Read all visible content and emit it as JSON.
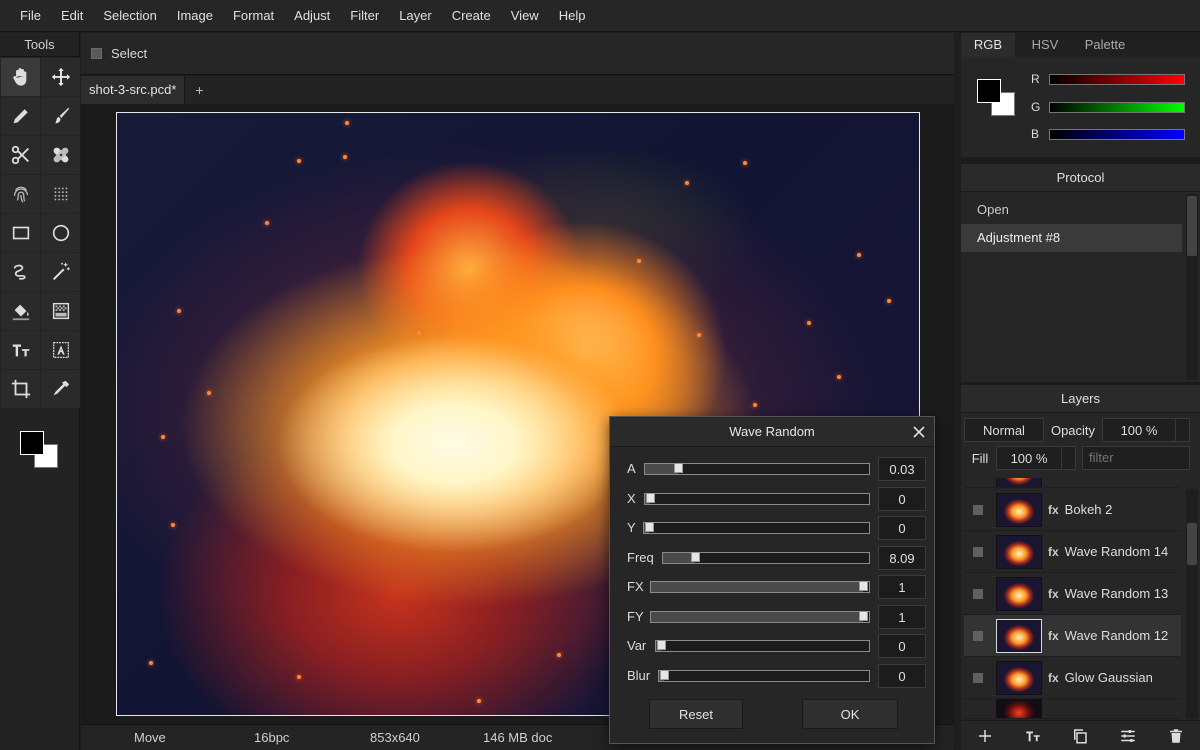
{
  "menu": [
    "File",
    "Edit",
    "Selection",
    "Image",
    "Format",
    "Adjust",
    "Filter",
    "Layer",
    "Create",
    "View",
    "Help"
  ],
  "tools": {
    "title": "Tools",
    "items": [
      "hand-icon",
      "move-icon",
      "pencil-icon",
      "brush-icon",
      "scissors-icon",
      "healing-icon",
      "fingerprint-icon",
      "dots-grid-icon",
      "rectangle-icon",
      "ellipse-icon",
      "lasso-icon",
      "magic-wand-icon",
      "fill-bucket-icon",
      "gradient-icon",
      "text-icon",
      "text-box-icon",
      "crop-icon",
      "eyedropper-icon"
    ],
    "fg_color": "#000000",
    "bg_color": "#ffffff"
  },
  "options": {
    "select_label": "Select"
  },
  "document": {
    "tab": "shot-3-src.pcd*",
    "add": "+"
  },
  "status": {
    "tool": "Move",
    "depth": "16bpc",
    "size": "853x640",
    "memory": "146 MB doc"
  },
  "color_panel": {
    "tabs": [
      "RGB",
      "HSV",
      "Palette"
    ],
    "channels": [
      {
        "label": "R",
        "color": "#ff0000"
      },
      {
        "label": "G",
        "color": "#00ff00"
      },
      {
        "label": "B",
        "color": "#0000ff"
      }
    ]
  },
  "protocol": {
    "title": "Protocol",
    "items": [
      "Open",
      "Adjustment  #8"
    ],
    "selected": 1
  },
  "layers": {
    "title": "Layers",
    "blend_mode": "Normal",
    "opacity_label": "Opacity",
    "opacity_value": "100 %",
    "fill_label": "Fill",
    "fill_value": "100 %",
    "filter_placeholder": "filter",
    "fx": "fx",
    "items": [
      "Bokeh 2",
      "Wave Random 14",
      "Wave Random 13",
      "Wave Random 12",
      "Glow Gaussian"
    ],
    "selected": 3
  },
  "dialog": {
    "title": "Wave Random",
    "params": [
      {
        "label": "A",
        "value": "0.03",
        "fraction": 0.13
      },
      {
        "label": "X",
        "value": "0",
        "fraction": 0.0
      },
      {
        "label": "Y",
        "value": "0",
        "fraction": 0.0
      },
      {
        "label": "Freq",
        "value": "8.09",
        "fraction": 0.14
      },
      {
        "label": "FX",
        "value": "1",
        "fraction": 1.0
      },
      {
        "label": "FY",
        "value": "1",
        "fraction": 1.0
      },
      {
        "label": "Var",
        "value": "0",
        "fraction": 0.0
      },
      {
        "label": "Blur",
        "value": "0",
        "fraction": 0.0
      }
    ],
    "reset_label": "Reset",
    "ok_label": "OK"
  }
}
